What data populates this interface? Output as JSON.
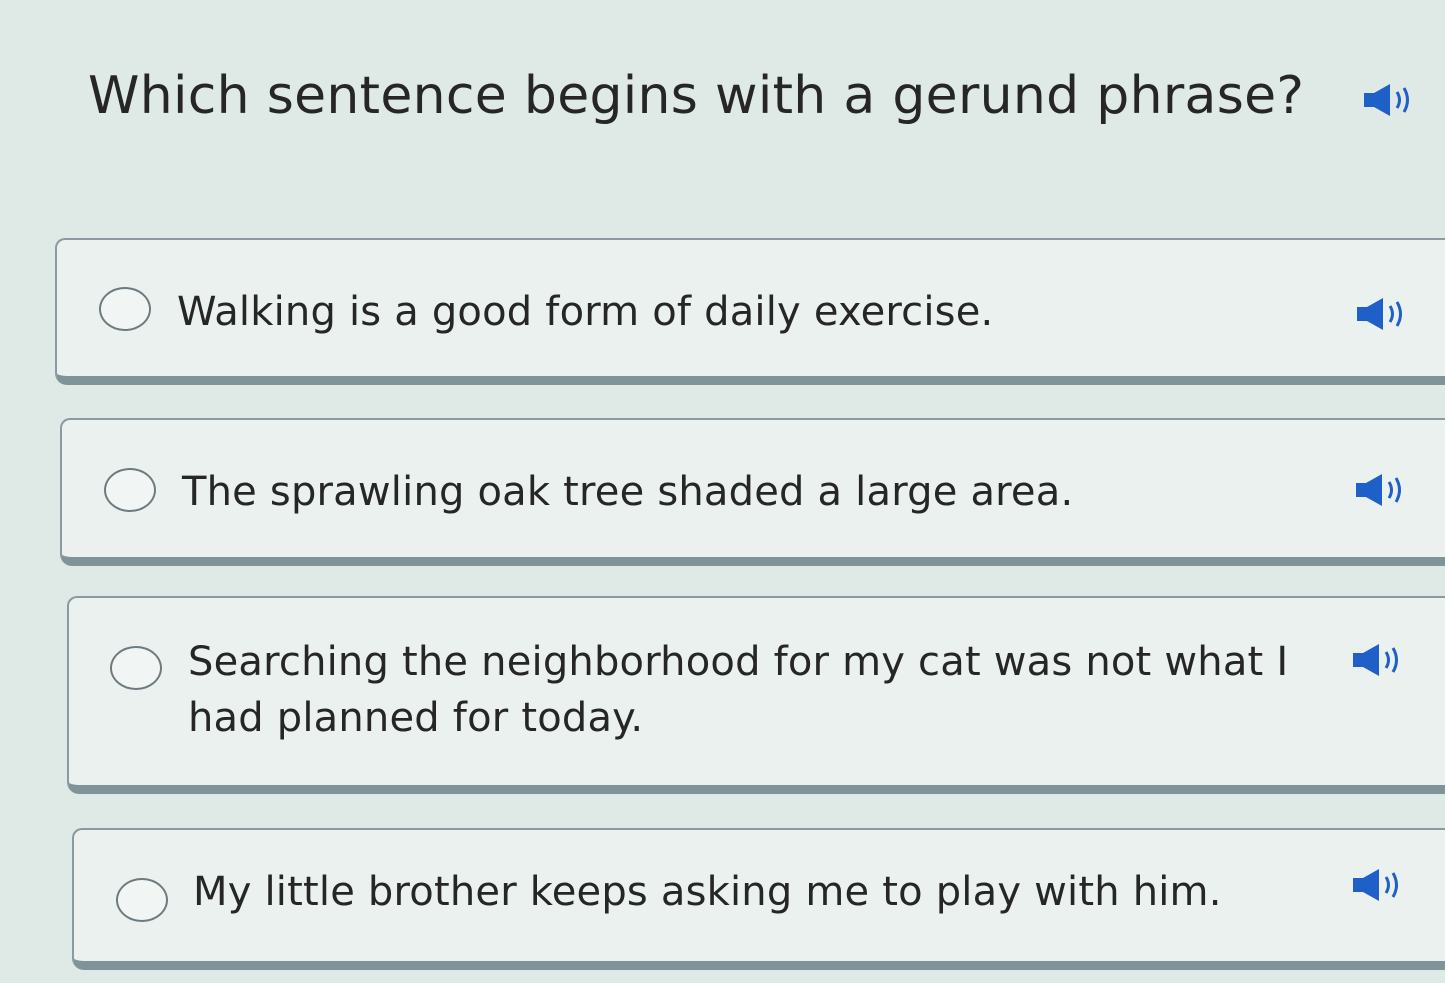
{
  "question": {
    "text": "Which sentence begins with a gerund phrase?",
    "audio_icon": "speaker-icon"
  },
  "choices": [
    {
      "text": "Walking is a good form of daily exercise.",
      "audio_icon": "speaker-icon",
      "selected": false
    },
    {
      "text": "The sprawling oak tree shaded a large area.",
      "audio_icon": "speaker-icon",
      "selected": false
    },
    {
      "text": "Searching the neighborhood for my cat was not what I had planned for today.",
      "audio_icon": "speaker-icon",
      "selected": false
    },
    {
      "text": "My little brother keeps asking me to play with him.",
      "audio_icon": "speaker-icon",
      "selected": false
    }
  ],
  "colors": {
    "speaker_blue": "#1f5fc8",
    "text": "#262626",
    "background": "#dfe9e6"
  }
}
